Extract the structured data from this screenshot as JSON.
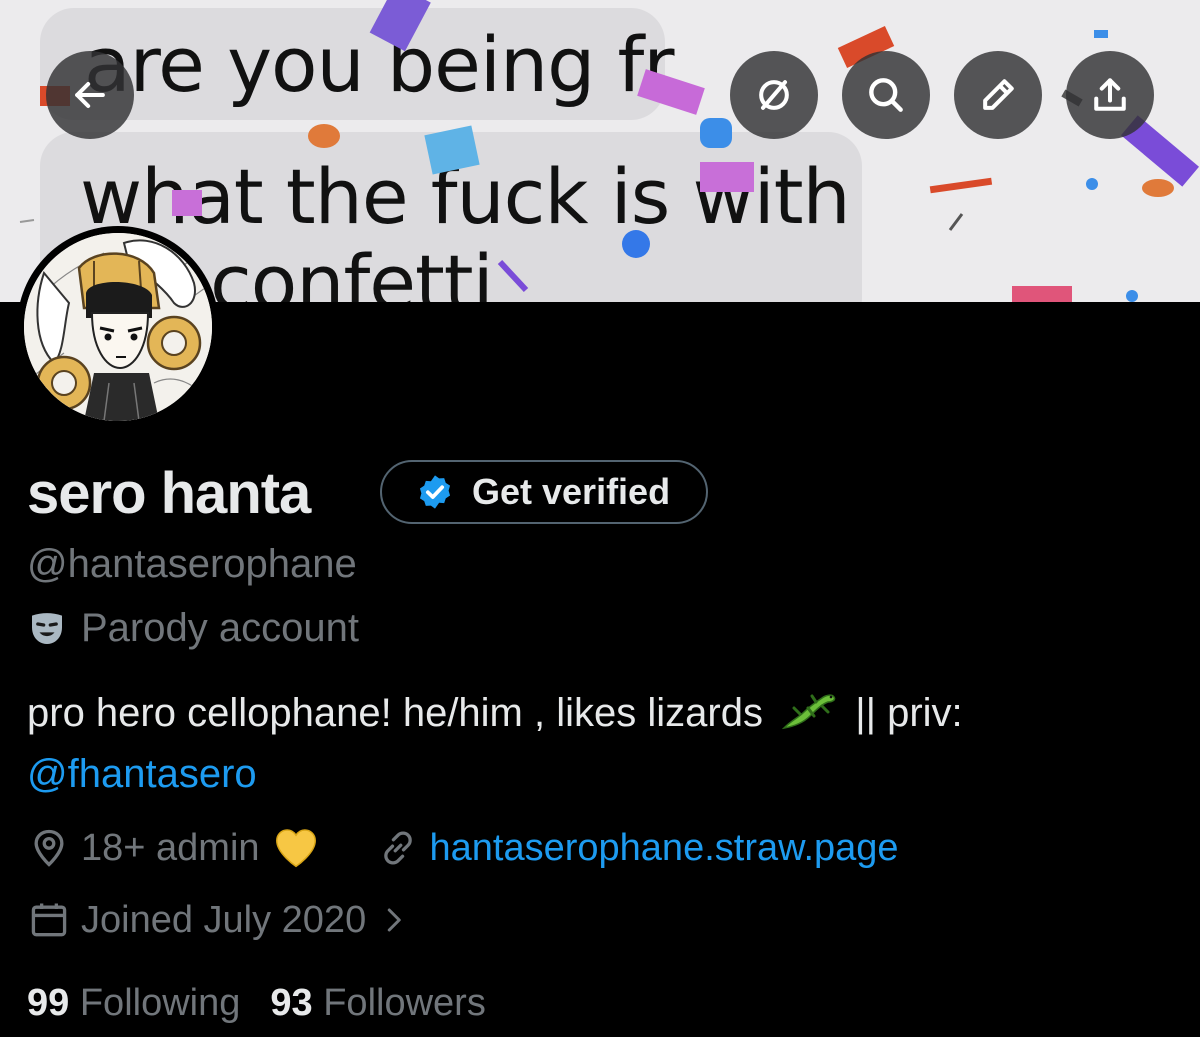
{
  "banner": {
    "message_lines": [
      "are you being fr",
      "what the fuck is with",
      "confetti"
    ]
  },
  "toolbar": {
    "back_icon": "arrow-left-icon",
    "grok_icon": "slashed-circle-icon",
    "search_icon": "search-icon",
    "edit_icon": "pencil-icon",
    "share_icon": "share-upload-icon"
  },
  "profile": {
    "display_name": "sero hanta",
    "get_verified_label": "Get verified",
    "handle": "@hantaserophane",
    "parody_label": "Parody account",
    "bio_text": "pro hero cellophane! he/him , likes lizards",
    "bio_suffix": "|| priv:",
    "bio_mention": "@fhantasero",
    "location": "18+ admin",
    "website": "hantaserophane.straw.page",
    "joined": "Joined July 2020",
    "following_count": "99",
    "following_label": "Following",
    "followers_count": "93",
    "followers_label": "Followers"
  },
  "colors": {
    "background": "#000000",
    "primary_text": "#e7e9ea",
    "secondary_text": "#71767b",
    "accent_blue": "#1d9bf0"
  }
}
